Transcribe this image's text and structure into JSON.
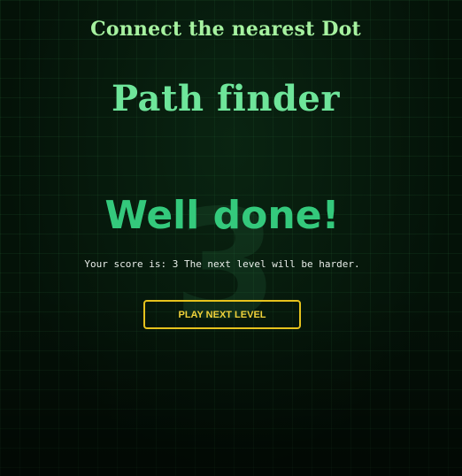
{
  "header": {
    "subtitle": "Connect the nearest Dot",
    "title": "Path finder"
  },
  "result": {
    "background_score": "3",
    "heading": "Well done!",
    "message": "Your score is: 3 The next level will be harder."
  },
  "actions": {
    "play_next_label": "PLAY NEXT LEVEL"
  },
  "colors": {
    "background": "#041208",
    "title": "#6ee59a",
    "subtitle": "#a6f2a0",
    "heading": "#34c97c",
    "button_border": "#e6c21d",
    "button_text": "#f1d23a"
  }
}
